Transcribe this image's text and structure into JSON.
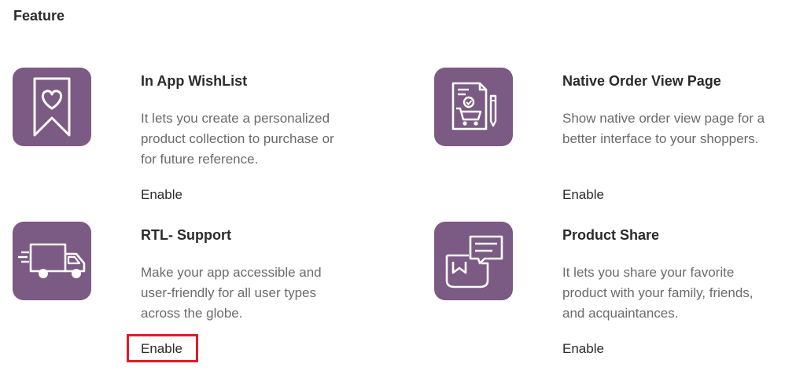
{
  "page": {
    "title": "Feature"
  },
  "colors": {
    "tile": "#7b5a83",
    "highlight": "#e31b23"
  },
  "features": [
    {
      "title": "In App WishList",
      "description": "It lets you create a personalized product collection to purchase or for future reference.",
      "action": "Enable",
      "icon": "wishlist-ribbon-heart-icon"
    },
    {
      "title": "Native Order View Page",
      "description": "Show native order view page for a better interface to your shoppers.",
      "action": "Enable",
      "icon": "order-document-cart-icon"
    },
    {
      "title": "RTL- Support",
      "description": "Make your app accessible and user-friendly for all user types across the globe.",
      "action": "Enable",
      "icon": "delivery-truck-icon"
    },
    {
      "title": "Product Share",
      "description": "It lets you share your favorite product with your family, friends, and acquaintances.",
      "action": "Enable",
      "icon": "share-bag-message-icon"
    }
  ]
}
